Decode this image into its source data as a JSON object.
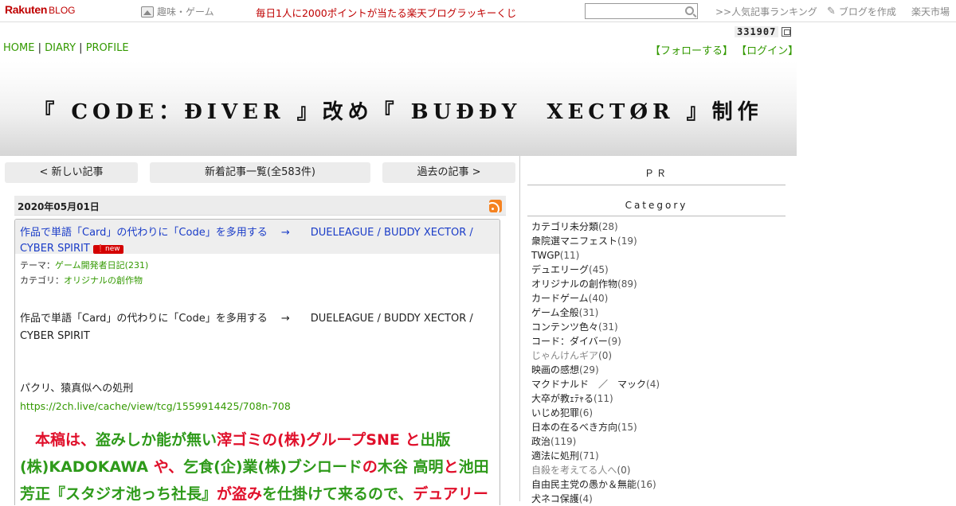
{
  "topbar": {
    "logo_main": "Rakuten",
    "logo_sub": "BLOG",
    "genre": "趣味・ゲーム",
    "promo": "毎日1人に2000ポイントが当たる楽天ブログラッキーくじ",
    "search_placeholder": "",
    "ranking": ">>人気記事ランキング",
    "create_blog": "ブログを作成",
    "ichiba": "楽天市場"
  },
  "counter": {
    "value": "331907"
  },
  "nav": {
    "home": "HOME",
    "diary": "DIARY",
    "profile": "PROFILE",
    "sep": "|"
  },
  "follow": {
    "follow": "【フォローする】",
    "login": "【ログイン】"
  },
  "header": {
    "title": "『 CODE：ĐIVER 』改め『 BUĐĐY　XECTØR 』制作"
  },
  "pager": {
    "newer": "< 新しい記事",
    "list": "新着記事一覧(全583件)",
    "older": "過去の記事 >"
  },
  "entry": {
    "date": "2020年05月01日",
    "title": "作品で単語「Card」の代わりに「Code」を多用する　 →　　DUELEAGUE / BUDDY XECTOR / CYBER SPIRIT",
    "new_badge": "new",
    "theme_label": "テーマ：",
    "theme_value": "ゲーム開発者日記(231)",
    "category_label": "カテゴリ：",
    "category_value": "オリジナルの創作物",
    "body_line1": "作品で単語「Card」の代わりに「Code」を多用する　 →　　DUELEAGUE / BUDDY XECTOR / CYBER SPIRIT",
    "body_line2": "パクリ、猿真似への処刑",
    "body_link": "https://2ch.live/cache/view/tcg/1559914425/708n-708",
    "big_parts": [
      "　本稿は、",
      "盗みしか能が無い",
      "滓ゴミの(株)グループSNE",
      " と",
      "出版(株)KADOKAWA",
      " や、",
      "乞食(企)業(株)ブシロード",
      "の",
      "木谷 高明",
      "と",
      "池田 芳正『スタジオ池っち社長』",
      "が盗み",
      "を仕掛けて来るので、",
      "デュアリー"
    ]
  },
  "sidebar": {
    "pr": "ＰＲ",
    "category": "Category",
    "items": [
      {
        "name": "カテゴリ未分類",
        "count": "(28)",
        "muted": false
      },
      {
        "name": "衆院選マニフェスト",
        "count": "(19)",
        "muted": false
      },
      {
        "name": "TWGP",
        "count": "(11)",
        "muted": false
      },
      {
        "name": "デュエリーグ",
        "count": "(45)",
        "muted": false
      },
      {
        "name": "オリジナルの創作物",
        "count": "(89)",
        "muted": false
      },
      {
        "name": "カードゲーム",
        "count": "(40)",
        "muted": false
      },
      {
        "name": "ゲーム全般",
        "count": "(31)",
        "muted": false
      },
      {
        "name": "コンテンツ色々",
        "count": "(31)",
        "muted": false
      },
      {
        "name": "コード：ダイバー",
        "count": "(9)",
        "muted": false
      },
      {
        "name": "じゃんけんギア",
        "count": "(0)",
        "muted": true
      },
      {
        "name": "映画の感想",
        "count": "(29)",
        "muted": false
      },
      {
        "name": "マクドナルド　／　マック",
        "count": "(4)",
        "muted": false
      },
      {
        "name": "大卒が教ｪﾃｬる",
        "count": "(11)",
        "muted": false
      },
      {
        "name": "いじめ犯罪",
        "count": "(6)",
        "muted": false
      },
      {
        "name": "日本の在るべき方向",
        "count": "(15)",
        "muted": false
      },
      {
        "name": "政治",
        "count": "(119)",
        "muted": false
      },
      {
        "name": "適法に処刑",
        "count": "(71)",
        "muted": false
      },
      {
        "name": "自殺を考えてる人へ",
        "count": "(0)",
        "muted": true
      },
      {
        "name": "自由民主党の愚か＆無能",
        "count": "(16)",
        "muted": false
      },
      {
        "name": "犬ネコ保護",
        "count": "(4)",
        "muted": false
      }
    ]
  }
}
